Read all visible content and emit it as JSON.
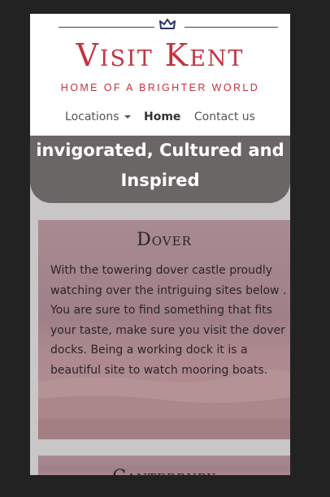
{
  "brand": {
    "title": "Visit Kent",
    "tagline": "HOME OF A BRIGHTER WORLD"
  },
  "nav": {
    "locations": "Locations",
    "home": "Home",
    "contact": "Contact us"
  },
  "hero": {
    "line1": "invigorated, Cultured and",
    "line2": "Inspired"
  },
  "cards": [
    {
      "title": "Dover",
      "body": "With the towering dover castle proudly watching over the intriguing sites below . You are sure to find something that fits your taste, make sure you visit the dover docks. Being a working dock it is a beautiful site to watch mooring boats."
    },
    {
      "title": "Canterbury"
    }
  ],
  "colors": {
    "brand_red": "#c1343e",
    "hero_bg": "#6a6666",
    "page_bg": "#c8c6c7",
    "outer_bg": "#222222"
  }
}
